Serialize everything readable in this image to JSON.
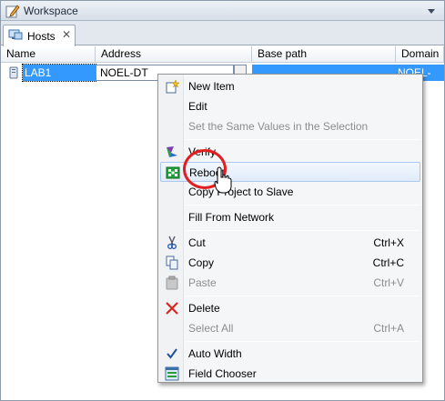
{
  "window": {
    "title": "Workspace"
  },
  "tabs": [
    {
      "label": "Hosts",
      "close": "✕"
    }
  ],
  "grid": {
    "columns": [
      "Name",
      "Address",
      "Base path",
      "Domain"
    ],
    "rows": [
      {
        "name": "LAB1",
        "address": "NOEL-DT",
        "base_path": "",
        "domain": "NOEL-DT"
      }
    ]
  },
  "context_menu": {
    "items": [
      {
        "label": "New Item",
        "icon": "new-item-icon",
        "enabled": true,
        "shortcut": ""
      },
      {
        "label": "Edit",
        "icon": "",
        "enabled": true,
        "shortcut": ""
      },
      {
        "label": "Set the Same Values in the Selection",
        "icon": "",
        "enabled": false,
        "shortcut": ""
      },
      {
        "label": "Verify",
        "icon": "verify-icon",
        "enabled": true,
        "shortcut": ""
      },
      {
        "label": "Reboot",
        "icon": "reboot-icon",
        "enabled": true,
        "shortcut": ""
      },
      {
        "label": "Copy Project to Slave",
        "icon": "",
        "enabled": true,
        "shortcut": ""
      },
      {
        "label": "Fill From Network",
        "icon": "",
        "enabled": true,
        "shortcut": ""
      },
      {
        "label": "Cut",
        "icon": "scissors-icon",
        "enabled": true,
        "shortcut": "Ctrl+X"
      },
      {
        "label": "Copy",
        "icon": "copy-icon",
        "enabled": true,
        "shortcut": "Ctrl+C"
      },
      {
        "label": "Paste",
        "icon": "paste-icon",
        "enabled": false,
        "shortcut": "Ctrl+V"
      },
      {
        "label": "Delete",
        "icon": "delete-icon",
        "enabled": true,
        "shortcut": ""
      },
      {
        "label": "Select All",
        "icon": "",
        "enabled": false,
        "shortcut": "Ctrl+A"
      },
      {
        "label": "Auto Width",
        "icon": "checkmark-icon",
        "enabled": true,
        "shortcut": ""
      },
      {
        "label": "Field Chooser",
        "icon": "field-chooser-icon",
        "enabled": true,
        "shortcut": ""
      }
    ]
  },
  "colors": {
    "selection": "#3399ff",
    "highlight_ring": "#e02020",
    "menu_bg": "#f5f6f7"
  }
}
